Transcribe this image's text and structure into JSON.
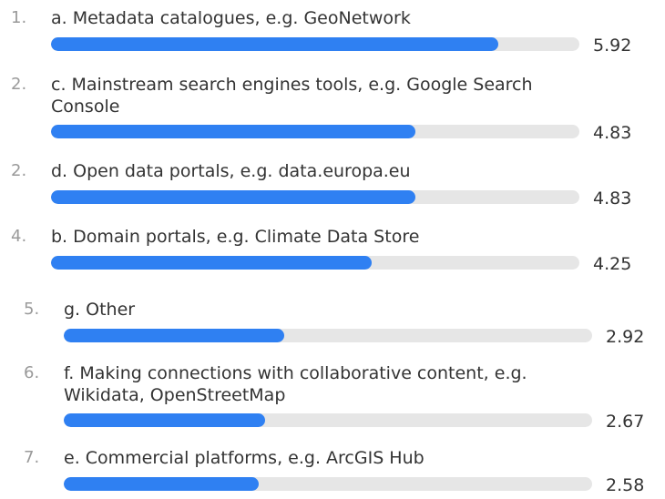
{
  "chart_data": {
    "type": "bar",
    "orientation": "horizontal",
    "ranks": [
      "1.",
      "2.",
      "2.",
      "4.",
      "5.",
      "6.",
      "7."
    ],
    "categories": [
      "a. Metadata catalogues, e.g. GeoNetwork",
      "c. Mainstream search engines tools, e.g. Google Search Console",
      "d. Open data portals, e.g. data.europa.eu",
      "b. Domain portals, e.g. Climate Data Store",
      "g. Other",
      "f. Making connections with collaborative content, e.g. Wikidata, OpenStreetMap",
      "e. Commercial platforms, e.g. ArcGIS Hub"
    ],
    "values": [
      5.92,
      4.83,
      4.83,
      4.25,
      2.92,
      2.67,
      2.58
    ],
    "value_labels": [
      "5.92",
      "4.83",
      "4.83",
      "4.25",
      "2.92",
      "2.67",
      "2.58"
    ],
    "xlim": [
      0,
      7
    ],
    "bar_color": "#2f80f2",
    "track_color": "#e6e6e6"
  }
}
